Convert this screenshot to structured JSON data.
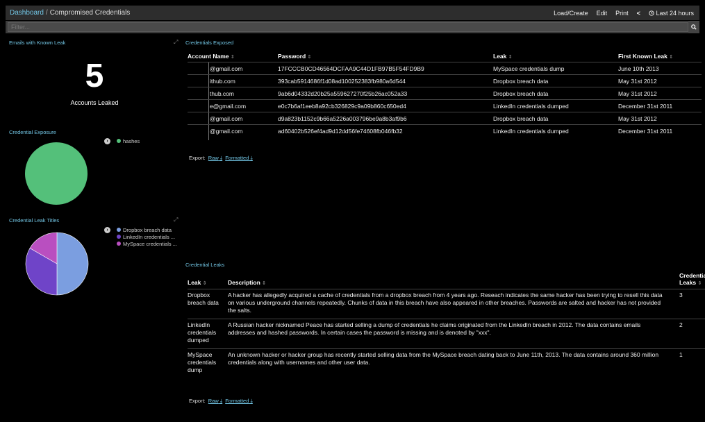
{
  "breadcrumb": {
    "root": "Dashboard",
    "separator": "/",
    "current": "Compromised Credentials"
  },
  "topmenu": {
    "load_create": "Load/Create",
    "edit": "Edit",
    "print": "Print",
    "prev": "<",
    "timerange": "Last 24 hours"
  },
  "filter": {
    "placeholder": "Filter..."
  },
  "emails_panel": {
    "title": "Emails with Known Leak",
    "value": "5",
    "label": "Accounts Leaked"
  },
  "exposure_panel": {
    "title": "Credential Exposure",
    "legend": [
      {
        "label": "hashes",
        "color": "#54c07a"
      }
    ]
  },
  "leak_titles_panel": {
    "title": "Credential Leak Titles",
    "legend": [
      {
        "label": "Dropbox breach data",
        "color": "#7b9ee0"
      },
      {
        "label": "LinkedIn credentials ...",
        "color": "#6f44c8"
      },
      {
        "label": "MySpace credentials ...",
        "color": "#b94fc0"
      }
    ]
  },
  "chart_data": [
    {
      "type": "pie",
      "title": "Credential Exposure",
      "categories": [
        "hashes"
      ],
      "values": [
        100
      ]
    },
    {
      "type": "pie",
      "title": "Credential Leak Titles",
      "categories": [
        "Dropbox breach data",
        "LinkedIn credentials dumped",
        "MySpace credentials dump"
      ],
      "values": [
        3,
        2,
        1
      ]
    }
  ],
  "credentials_exposed": {
    "title": "Credentials Exposed",
    "columns": [
      "Account Name",
      "Password",
      "Leak",
      "First Known Leak"
    ],
    "rows": [
      [
        "@gmail.com",
        "17FCCCB0CD46564DCFAA9C44D1FB97B5F54FD9B9",
        "MySpace credentials dump",
        "June 10th 2013"
      ],
      [
        "ithub.com",
        "393cab5914686f1d08ad100252383fb980a6d544",
        "Dropbox breach data",
        "May 31st 2012"
      ],
      [
        "thub.com",
        "9ab6d04332d20b25a559627270f25b26ac052a33",
        "Dropbox breach data",
        "May 31st 2012"
      ],
      [
        "e@gmail.com",
        "e0c7b6af1eeb8a92cb326829c9a09b860c650ed4",
        "LinkedIn credentials dumped",
        "December 31st 2011"
      ],
      [
        "@gmail.com",
        "d9a823b1152c9b66a5226a003796be9a8b3af9b6",
        "Dropbox breach data",
        "May 31st 2012"
      ],
      [
        "@gmail.com",
        "ad60402b526ef4ad9d12dd56fe74608fb046fb32",
        "LinkedIn credentials dumped",
        "December 31st 2011"
      ]
    ],
    "export_label": "Export:",
    "raw": "Raw",
    "formatted": "Formatted"
  },
  "credential_leaks": {
    "title": "Credential Leaks",
    "columns": [
      "Leak",
      "Description",
      "Credential Leaks"
    ],
    "rows": [
      [
        "Dropbox breach data",
        "A hacker has allegedly acquired a cache of credentials from a dropbox breach from 4 years ago. Reseach indicates the same hacker has been trying to resell this data on various underground channels repeatedly. Chunks of data in this breach have also appeared in other breaches. Passwords are salted and hacker has not provided the salts.",
        "3"
      ],
      [
        "LinkedIn credentials dumped",
        "A Russian hacker nicknamed Peace has started selling a dump of credentials he claims originated from the LinkedIn breach in 2012. The data contains emails addresses and hashed passwords. In certain cases the password is missing and is denoted by \"xxx\".",
        "2"
      ],
      [
        "MySpace credentials dump",
        "An unknown hacker or hacker group has recently started selling data from the MySpace breach dating back to June 11th, 2013. The data contains around 360 million credentials along with usernames and other user data.",
        "1"
      ]
    ],
    "export_label": "Export:",
    "raw": "Raw",
    "formatted": "Formatted"
  }
}
